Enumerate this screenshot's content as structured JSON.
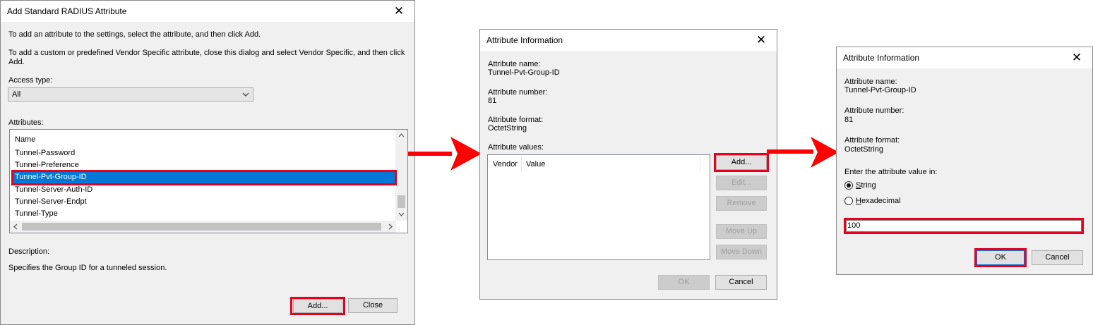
{
  "dialog1": {
    "title": "Add Standard RADIUS Attribute",
    "instruction1": "To add an attribute to the settings, select the attribute, and then click Add.",
    "instruction2_line1": "To add a custom or predefined Vendor Specific attribute, close this dialog and select Vendor Specific, and then click",
    "instruction2_line2": "Add.",
    "access_type_label": "Access type:",
    "access_type_value": "All",
    "attributes_label": "Attributes:",
    "list_header": "Name",
    "list_items": [
      "Tunnel-Password",
      "Tunnel-Preference",
      "Tunnel-Pvt-Group-ID",
      "Tunnel-Server-Auth-ID",
      "Tunnel-Server-Endpt",
      "Tunnel-Type"
    ],
    "selected_item": "Tunnel-Pvt-Group-ID",
    "description_label": "Description:",
    "description_text": "Specifies the Group ID for a tunneled session.",
    "add_button": "Add...",
    "close_button": "Close"
  },
  "dialog2": {
    "title": "Attribute Information",
    "attr_name_label": "Attribute name:",
    "attr_name_value": "Tunnel-Pvt-Group-ID",
    "attr_number_label": "Attribute number:",
    "attr_number_value": "81",
    "attr_format_label": "Attribute format:",
    "attr_format_value": "OctetString",
    "attr_values_label": "Attribute values:",
    "col_vendor": "Vendor",
    "col_value": "Value",
    "add_button": "Add...",
    "edit_button": "Edit...",
    "remove_button": "Remove",
    "move_up_button": "Move Up",
    "move_down_button": "Move Down",
    "ok_button": "OK",
    "cancel_button": "Cancel"
  },
  "dialog3": {
    "title": "Attribute Information",
    "attr_name_label": "Attribute name:",
    "attr_name_value": "Tunnel-Pvt-Group-ID",
    "attr_number_label": "Attribute number:",
    "attr_number_value": "81",
    "attr_format_label": "Attribute format:",
    "attr_format_value": "OctetString",
    "enter_value_label": "Enter the attribute value in:",
    "radio_string_label": "String",
    "radio_hex_label": "Hexadecimal",
    "value_input": "100",
    "ok_button": "OK",
    "cancel_button": "Cancel"
  },
  "colors": {
    "highlight": "#e8001c",
    "selection": "#0078d7",
    "arrow": "#ff0000"
  }
}
